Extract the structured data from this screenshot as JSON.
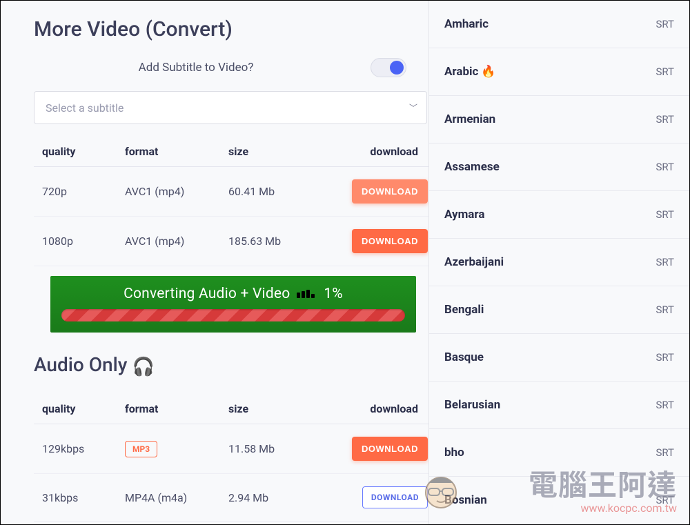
{
  "main": {
    "section_video_title": "More Video (Convert)",
    "subtitle_toggle_label": "Add Subtitle to Video?",
    "select_placeholder": "Select a subtitle",
    "headers": {
      "quality": "quality",
      "format": "format",
      "size": "size",
      "download": "download"
    },
    "download_label": "DOWNLOAD",
    "video_rows": [
      {
        "quality": "720p",
        "format": "AVC1 (mp4)",
        "size": "60.41 Mb",
        "btn_variant": "light"
      },
      {
        "quality": "1080p",
        "format": "AVC1 (mp4)",
        "size": "185.63 Mb",
        "btn_variant": ""
      }
    ],
    "progress": {
      "text_prefix": "Converting Audio + Video",
      "text_suffix": "1%"
    },
    "section_audio_title": "Audio Only",
    "audio_icon": "🎧",
    "audio_rows": [
      {
        "quality": "129kbps",
        "format": "MP3",
        "format_style": "badge",
        "size": "11.58 Mb",
        "btn": "DOWNLOAD",
        "btn_variant": ""
      },
      {
        "quality": "31kbps",
        "format": "MP4A (m4a)",
        "format_style": "plain",
        "size": "2.94 Mb",
        "btn": "DOWNLOAD",
        "btn_variant": "outline"
      }
    ]
  },
  "subs": [
    {
      "name": "Amharic",
      "flag": "",
      "ext": "SRT"
    },
    {
      "name": "Arabic",
      "flag": "🔥",
      "ext": "SRT"
    },
    {
      "name": "Armenian",
      "flag": "",
      "ext": "SRT"
    },
    {
      "name": "Assamese",
      "flag": "",
      "ext": "SRT"
    },
    {
      "name": "Aymara",
      "flag": "",
      "ext": "SRT"
    },
    {
      "name": "Azerbaijani",
      "flag": "",
      "ext": "SRT"
    },
    {
      "name": "Bengali",
      "flag": "",
      "ext": "SRT"
    },
    {
      "name": "Basque",
      "flag": "",
      "ext": "SRT"
    },
    {
      "name": "Belarusian",
      "flag": "",
      "ext": "SRT"
    },
    {
      "name": "bho",
      "flag": "",
      "ext": "SRT"
    },
    {
      "name": "Bosnian",
      "flag": "",
      "ext": "SRT"
    }
  ],
  "watermark": {
    "cn": "電腦王阿達",
    "url": "www.kocpc.com.tw"
  }
}
